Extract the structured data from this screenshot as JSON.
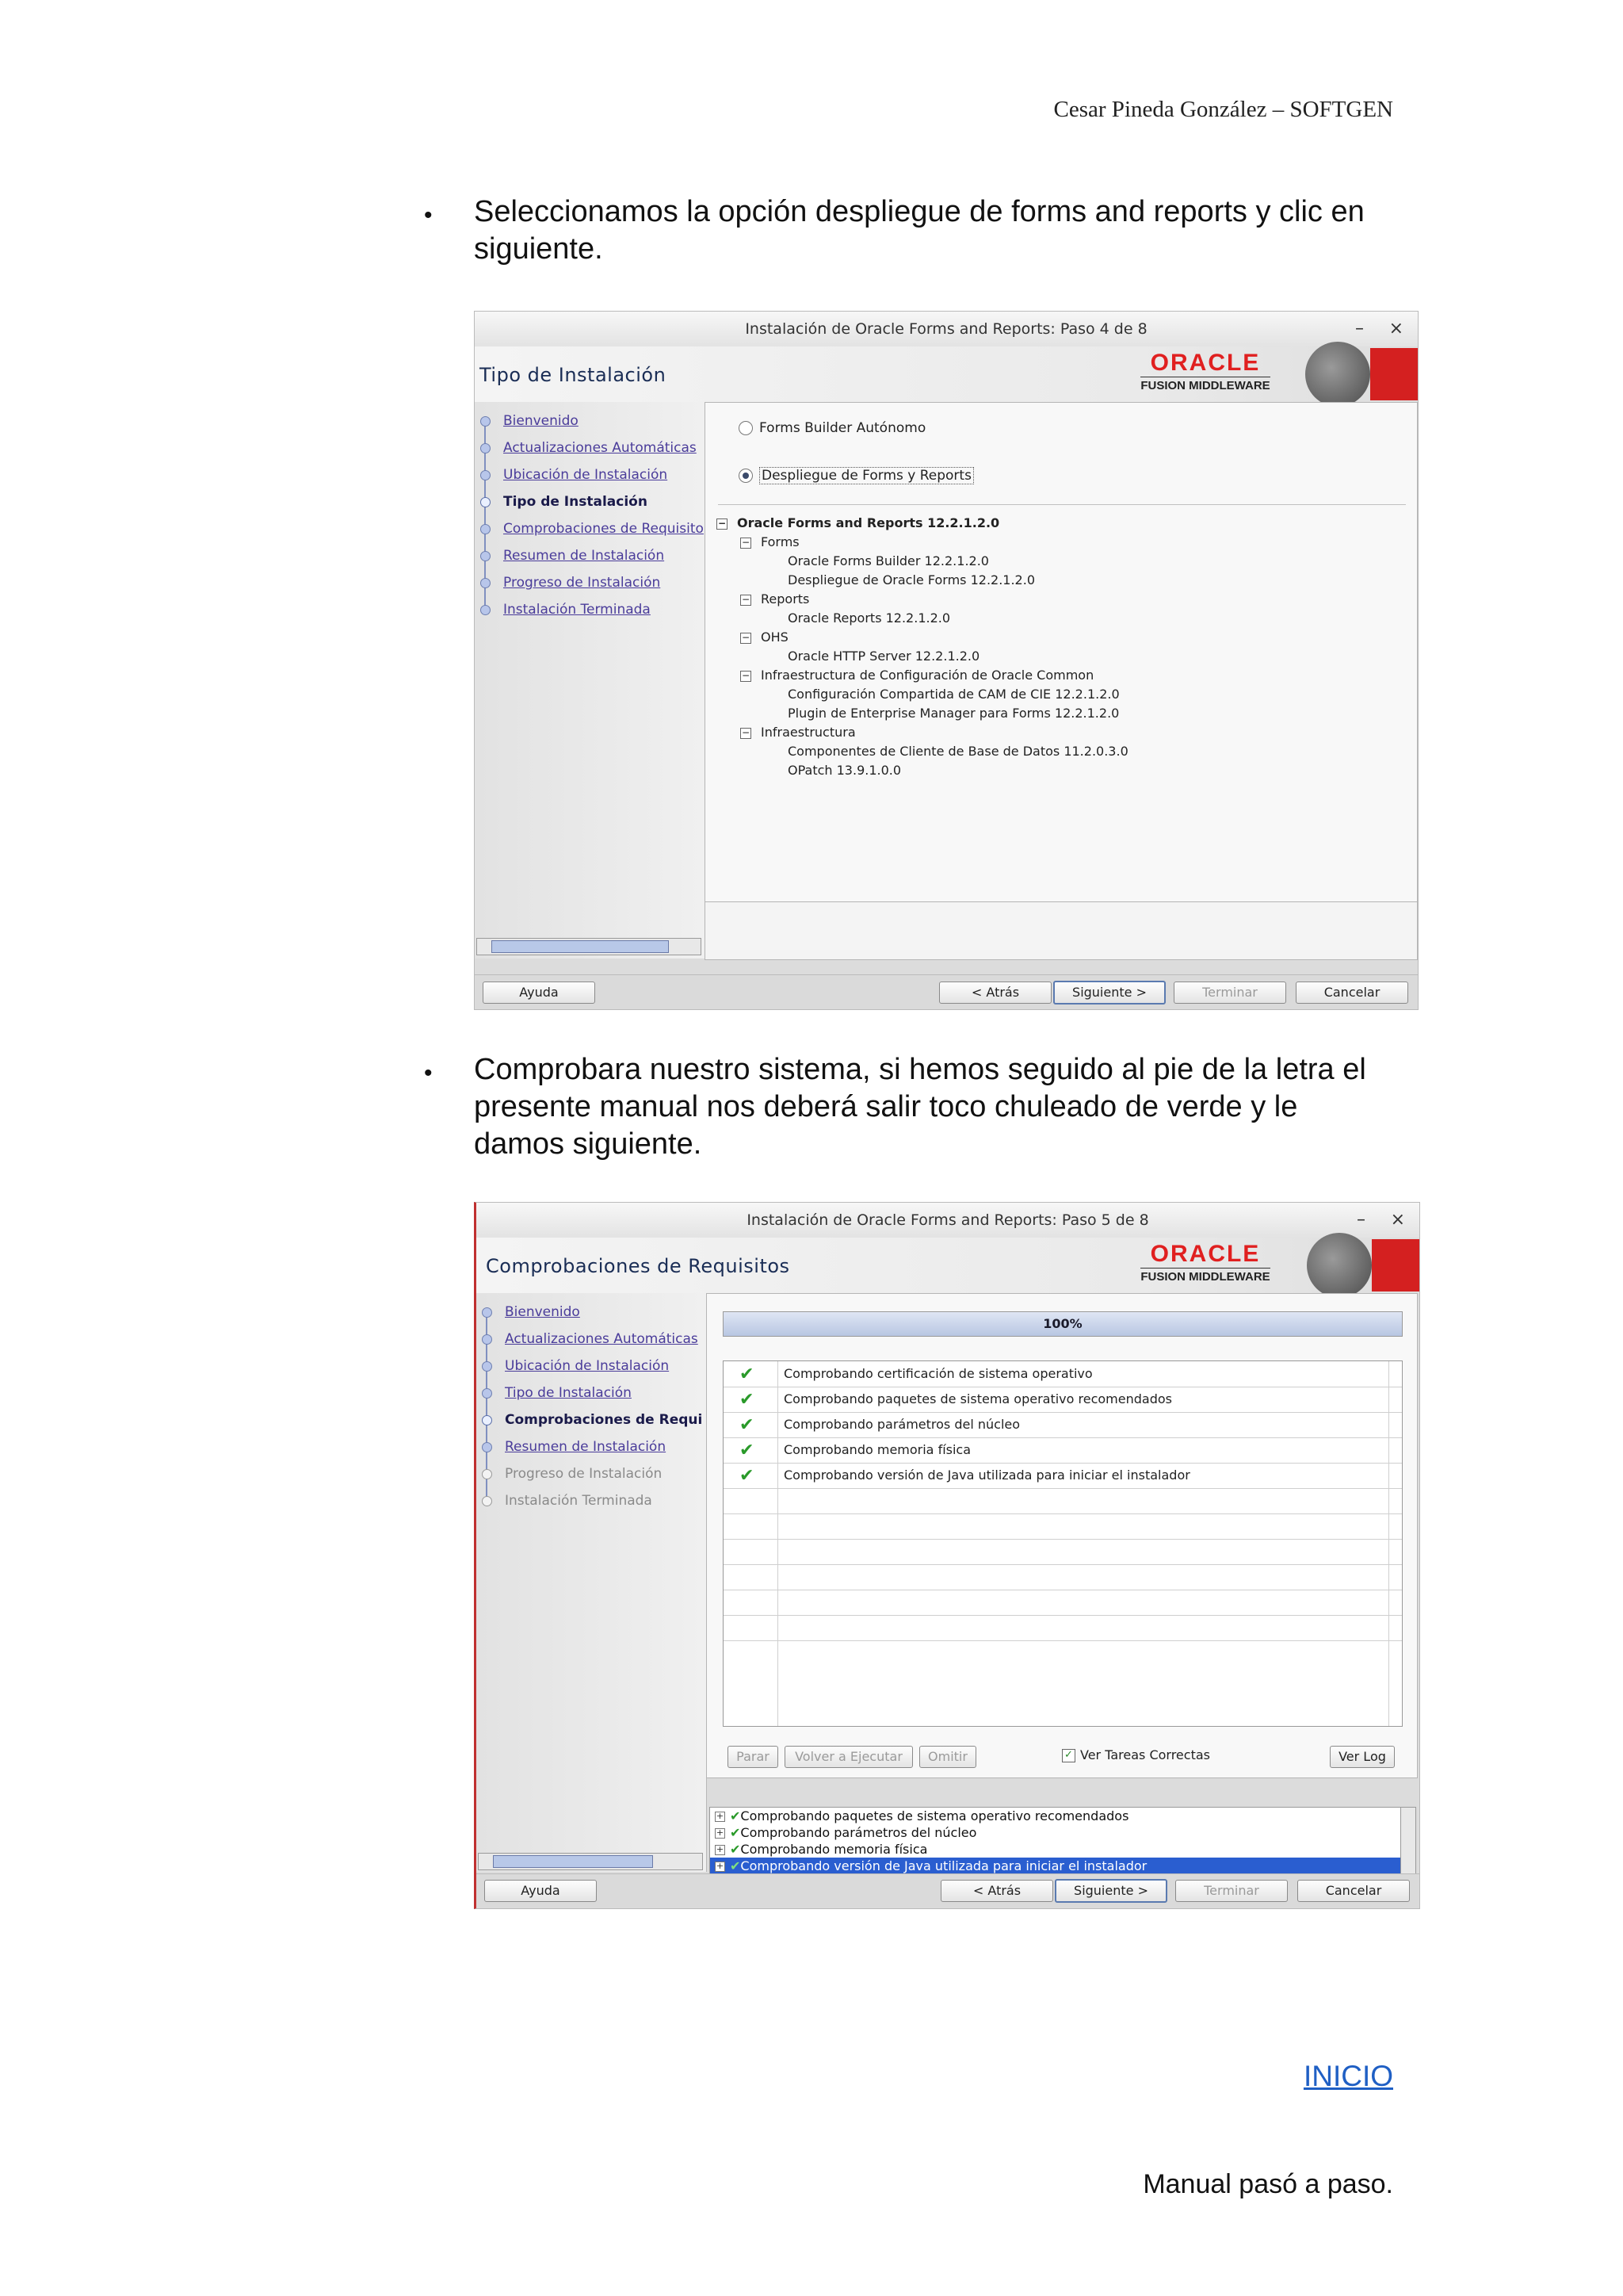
{
  "header": {
    "author": "Cesar Pineda González  –  SOFTGEN"
  },
  "bullets": [
    {
      "line1": "Seleccionamos la opción despliegue de forms and reports y clic en",
      "line2": "siguiente."
    },
    {
      "line1": "Comprobara nuestro sistema, si hemos seguido al pie de la letra el",
      "line2": "presente manual nos deberá salir toco chuleado de verde y le",
      "line3": "damos siguiente."
    }
  ],
  "window1": {
    "title": "Instalación de Oracle Forms and Reports: Paso 4 de 8",
    "minimize": "–",
    "close": "×",
    "step_title": "Tipo de Instalación",
    "logo": {
      "brand": "ORACLE",
      "sub": "FUSION MIDDLEWARE"
    },
    "nav": [
      {
        "label": "Bienvenido",
        "state": "link"
      },
      {
        "label": "Actualizaciones Automáticas",
        "state": "link"
      },
      {
        "label": "Ubicación de Instalación",
        "state": "link"
      },
      {
        "label": "Tipo de Instalación",
        "state": "current"
      },
      {
        "label": "Comprobaciones de Requisito",
        "state": "link"
      },
      {
        "label": "Resumen de Instalación",
        "state": "link"
      },
      {
        "label": "Progreso de Instalación",
        "state": "link"
      },
      {
        "label": "Instalación Terminada",
        "state": "link"
      }
    ],
    "options": [
      {
        "label": "Forms Builder Autónomo",
        "selected": false
      },
      {
        "label": "Despliegue de Forms y Reports",
        "selected": true
      }
    ],
    "tree": [
      {
        "text": "Oracle Forms and Reports 12.2.1.2.0",
        "level": 0,
        "expander": "⊟"
      },
      {
        "text": "Forms",
        "level": 1,
        "expander": "⊟"
      },
      {
        "text": "Oracle Forms Builder 12.2.1.2.0",
        "level": 2
      },
      {
        "text": "Despliegue de Oracle Forms 12.2.1.2.0",
        "level": 2
      },
      {
        "text": "Reports",
        "level": 1,
        "expander": "⊟"
      },
      {
        "text": "Oracle Reports 12.2.1.2.0",
        "level": 2
      },
      {
        "text": "OHS",
        "level": 1,
        "expander": "⊟"
      },
      {
        "text": "Oracle HTTP Server 12.2.1.2.0",
        "level": 2
      },
      {
        "text": "Infraestructura de Configuración de Oracle Common",
        "level": 1,
        "expander": "⊟"
      },
      {
        "text": "Configuración Compartida de CAM de CIE 12.2.1.2.0",
        "level": 2
      },
      {
        "text": "Plugin de Enterprise Manager para Forms 12.2.1.2.0",
        "level": 2
      },
      {
        "text": "Infraestructura",
        "level": 1,
        "expander": "⊟"
      },
      {
        "text": "Componentes de Cliente de Base de Datos 11.2.0.3.0",
        "level": 2
      },
      {
        "text": "OPatch 13.9.1.0.0",
        "level": 2
      }
    ],
    "buttons": {
      "help": "Ayuda",
      "back": "< Atrás",
      "next": "Siguiente >",
      "finish": "Terminar",
      "cancel": "Cancelar"
    }
  },
  "window2": {
    "title": "Instalación de Oracle Forms and Reports: Paso 5 de 8",
    "minimize": "–",
    "close": "×",
    "step_title": "Comprobaciones de Requisitos",
    "logo": {
      "brand": "ORACLE",
      "sub": "FUSION MIDDLEWARE"
    },
    "nav": [
      {
        "label": "Bienvenido",
        "state": "link"
      },
      {
        "label": "Actualizaciones Automáticas",
        "state": "link"
      },
      {
        "label": "Ubicación de Instalación",
        "state": "link"
      },
      {
        "label": "Tipo de Instalación",
        "state": "link"
      },
      {
        "label": "Comprobaciones de Requi",
        "state": "current"
      },
      {
        "label": "Resumen de Instalación",
        "state": "link"
      },
      {
        "label": "Progreso de Instalación",
        "state": "disabled"
      },
      {
        "label": "Instalación Terminada",
        "state": "disabled"
      }
    ],
    "progress": {
      "label": "100%",
      "value": 100
    },
    "checks": [
      {
        "icon": "✔",
        "text": "Comprobando certificación de sistema operativo"
      },
      {
        "icon": "✔",
        "text": "Comprobando paquetes de sistema operativo recomendados"
      },
      {
        "icon": "✔",
        "text": "Comprobando parámetros del núcleo"
      },
      {
        "icon": "✔",
        "text": "Comprobando memoria física"
      },
      {
        "icon": "✔",
        "text": "Comprobando versión de Java utilizada para iniciar el instalador"
      }
    ],
    "controls": {
      "stop": "Parar",
      "rerun": "Volver a Ejecutar",
      "skip": "Omitir",
      "show_ok": "Ver Tareas Correctas",
      "show_ok_checked": true,
      "view_log": "Ver Log"
    },
    "log": [
      {
        "text": "Comprobando paquetes de sistema operativo recomendados",
        "selected": false
      },
      {
        "text": "Comprobando parámetros del núcleo",
        "selected": false
      },
      {
        "text": "Comprobando memoria física",
        "selected": false
      },
      {
        "text": "Comprobando versión de Java utilizada para iniciar el instalador",
        "selected": true
      }
    ],
    "buttons": {
      "help": "Ayuda",
      "back": "< Atrás",
      "next": "Siguiente >",
      "finish": "Terminar",
      "cancel": "Cancelar"
    }
  },
  "links": {
    "inicio": "INICIO"
  },
  "footer": {
    "text": "Manual pasó a paso."
  },
  "colors": {
    "oracle_red": "#e02020",
    "link": "#1f5fc4",
    "check_green": "#2a9a2a",
    "selection_blue": "#2a5ed0"
  }
}
